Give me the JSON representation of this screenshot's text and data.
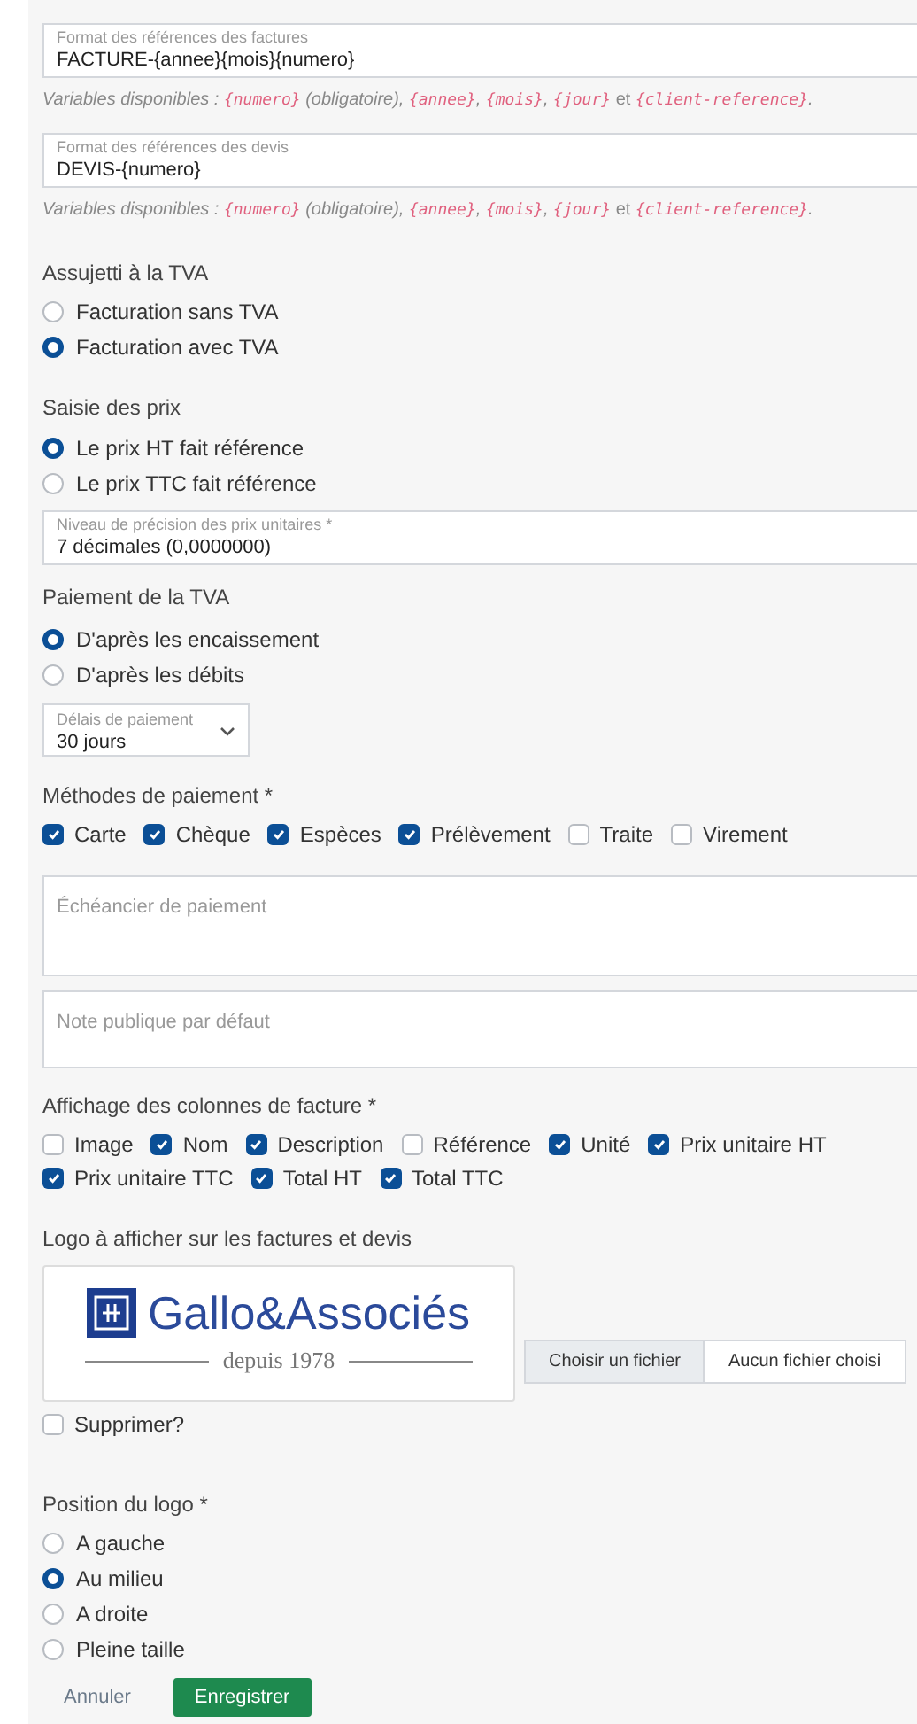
{
  "reference_fields": [
    {
      "label": "Format des références des factures",
      "value": "FACTURE-{annee}{mois}{numero}",
      "help": [
        {
          "kind": "text",
          "text": "Variables disponibles : "
        },
        {
          "kind": "code",
          "text": "{numero}"
        },
        {
          "kind": "text",
          "text": " (obligatoire), "
        },
        {
          "kind": "code",
          "text": "{annee}"
        },
        {
          "kind": "text",
          "text": ", "
        },
        {
          "kind": "code",
          "text": "{mois}"
        },
        {
          "kind": "text",
          "text": ", "
        },
        {
          "kind": "code",
          "text": "{jour}"
        },
        {
          "kind": "plain",
          "text": " et "
        },
        {
          "kind": "code",
          "text": "{client-reference}"
        },
        {
          "kind": "text",
          "text": "."
        }
      ]
    },
    {
      "label": "Format des références des devis",
      "value": "DEVIS-{numero}",
      "help": [
        {
          "kind": "text",
          "text": "Variables disponibles : "
        },
        {
          "kind": "code",
          "text": "{numero}"
        },
        {
          "kind": "text",
          "text": " (obligatoire), "
        },
        {
          "kind": "code",
          "text": "{annee}"
        },
        {
          "kind": "text",
          "text": ", "
        },
        {
          "kind": "code",
          "text": "{mois}"
        },
        {
          "kind": "text",
          "text": ", "
        },
        {
          "kind": "code",
          "text": "{jour}"
        },
        {
          "kind": "plain",
          "text": " et "
        },
        {
          "kind": "code",
          "text": "{client-reference}"
        },
        {
          "kind": "text",
          "text": "."
        }
      ]
    }
  ],
  "vat_subject": {
    "label": "Assujetti à la TVA",
    "options": [
      {
        "label": "Facturation sans TVA",
        "selected": false
      },
      {
        "label": "Facturation avec TVA",
        "selected": true
      }
    ]
  },
  "price_entry": {
    "label": "Saisie des prix",
    "options": [
      {
        "label": "Le prix HT fait référence",
        "selected": true
      },
      {
        "label": "Le prix TTC fait référence",
        "selected": false
      }
    ]
  },
  "precision_select": {
    "label": "Niveau de précision des prix unitaires *",
    "value": "7 décimales (0,0000000)"
  },
  "vat_payment": {
    "label": "Paiement de la TVA",
    "options": [
      {
        "label": "D'après les encaissement",
        "selected": true
      },
      {
        "label": "D'après les débits",
        "selected": false
      }
    ]
  },
  "payment_terms_select": {
    "label": "Délais de paiement",
    "value": "30 jours"
  },
  "payment_methods": {
    "label": "Méthodes de paiement *",
    "options": [
      {
        "label": "Carte",
        "checked": true
      },
      {
        "label": "Chèque",
        "checked": true
      },
      {
        "label": "Espèces",
        "checked": true
      },
      {
        "label": "Prélèvement",
        "checked": true
      },
      {
        "label": "Traite",
        "checked": false
      },
      {
        "label": "Virement",
        "checked": false
      }
    ]
  },
  "payment_schedule": {
    "placeholder": "Échéancier de paiement"
  },
  "public_note": {
    "placeholder": "Note publique par défaut"
  },
  "invoice_columns": {
    "label": "Affichage des colonnes de facture *",
    "options": [
      {
        "label": "Image",
        "checked": false
      },
      {
        "label": "Nom",
        "checked": true
      },
      {
        "label": "Description",
        "checked": true
      },
      {
        "label": "Référence",
        "checked": false
      },
      {
        "label": "Unité",
        "checked": true
      },
      {
        "label": "Prix unitaire HT",
        "checked": true
      },
      {
        "label": "Prix unitaire TTC",
        "checked": true
      },
      {
        "label": "Total HT",
        "checked": true
      },
      {
        "label": "Total TTC",
        "checked": true
      }
    ]
  },
  "logo": {
    "label": "Logo à afficher sur les factures et devis",
    "company": "Gallo&Associés",
    "tagline": "depuis 1978",
    "file_button": "Choisir un fichier",
    "file_status": "Aucun fichier choisi",
    "delete": {
      "label": "Supprimer?",
      "checked": false
    }
  },
  "logo_position": {
    "label": "Position du logo *",
    "options": [
      {
        "label": "A gauche",
        "selected": false
      },
      {
        "label": "Au milieu",
        "selected": true
      },
      {
        "label": "A droite",
        "selected": false
      },
      {
        "label": "Pleine taille",
        "selected": false
      }
    ]
  },
  "actions": [
    {
      "kind": "link",
      "label": "Annuler"
    },
    {
      "kind": "primary",
      "label": "Enregistrer"
    }
  ]
}
